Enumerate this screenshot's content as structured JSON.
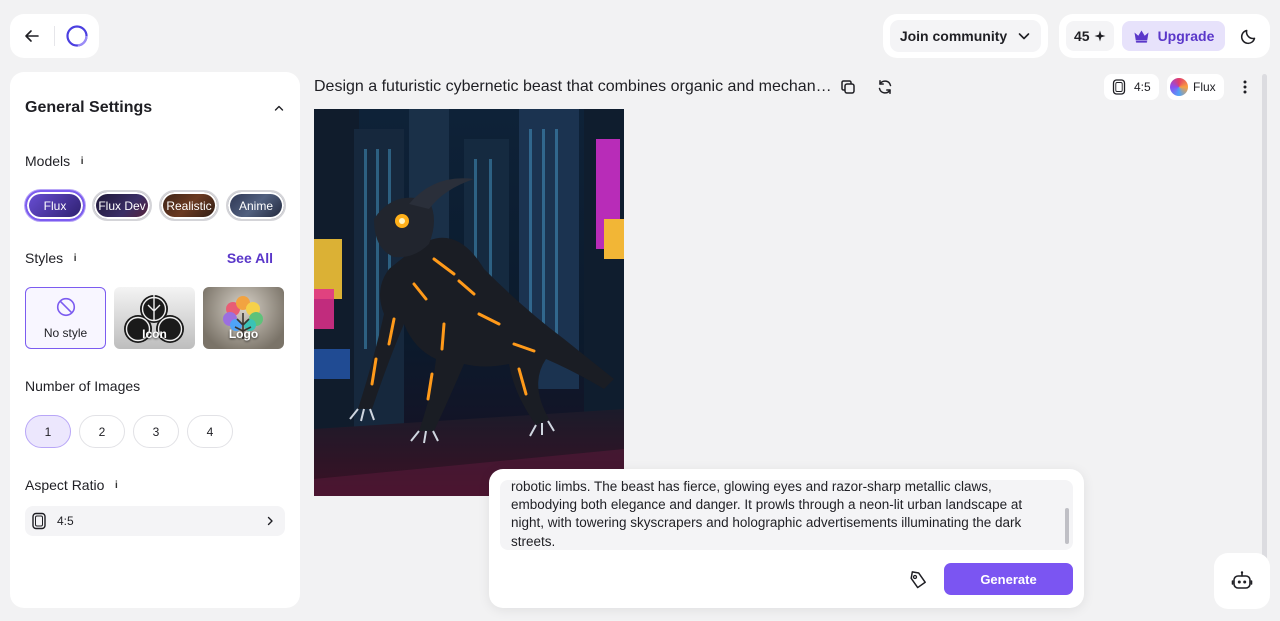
{
  "nav": {
    "back_icon": "arrow-left-icon",
    "logo_icon": "ring-logo-icon"
  },
  "header": {
    "community_label": "Join community",
    "credits": "45",
    "upgrade_label": "Upgrade"
  },
  "sidebar": {
    "title": "General Settings",
    "models_label": "Models",
    "models": [
      {
        "label": "Flux",
        "selected": true
      },
      {
        "label": "Flux Dev",
        "selected": false
      },
      {
        "label": "Realistic",
        "selected": false
      },
      {
        "label": "Anime",
        "selected": false
      }
    ],
    "styles_label": "Styles",
    "see_all_label": "See All",
    "styles": [
      {
        "label": "No style",
        "selected": true
      },
      {
        "label": "Icon",
        "selected": false
      },
      {
        "label": "Logo",
        "selected": false
      }
    ],
    "num_images_label": "Number of Images",
    "num_images": [
      "1",
      "2",
      "3",
      "4"
    ],
    "num_images_selected": "1",
    "aspect_label": "Aspect Ratio",
    "aspect_value": "4:5",
    "info_glyph": "i"
  },
  "main": {
    "prompt_title": "Design a futuristic cybernetic beast that combines organic and mechanical elements...",
    "ratio": "4:5",
    "model": "Flux"
  },
  "prompt_box": {
    "text": "robotic limbs. The beast has fierce, glowing eyes and razor-sharp metallic claws, embodying both elegance and danger. It prowls through a neon-lit urban landscape at night, with towering skyscrapers and holographic advertisements illuminating the dark streets.",
    "generate_label": "Generate"
  },
  "colors": {
    "accent": "#7b55f2",
    "accent_light": "#e7e2fb",
    "accent_text": "#5a37c9"
  }
}
